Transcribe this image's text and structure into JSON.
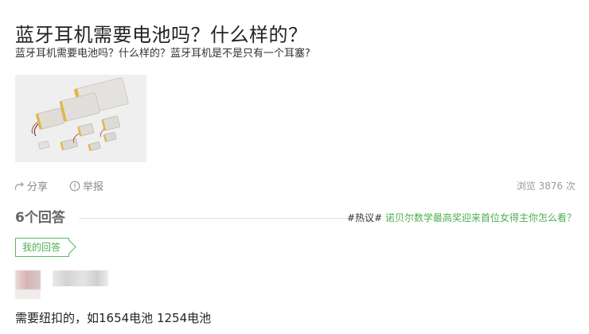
{
  "question": {
    "title": "蓝牙耳机需要电池吗？什么样的？",
    "description": "蓝牙耳机需要电池吗？什么样的？蓝牙耳机是不是只有一个耳塞?"
  },
  "actions": {
    "share_label": "分享",
    "report_label": "举报",
    "view_count": "浏览 3876 次"
  },
  "answers": {
    "count_label": "6个回答",
    "hot_tag": "#热议#",
    "hot_topic": " 诺贝尔数学最高奖迎来首位女得主你怎么看？",
    "my_answer_tab": "我的回答"
  },
  "answer": {
    "text": "需要纽扣的，如1654电池 1254电池"
  },
  "colors": {
    "accent_green": "#4caf50",
    "title": "#222222",
    "muted": "#888888"
  },
  "icons": {
    "share": "share-icon",
    "report": "report-icon"
  }
}
